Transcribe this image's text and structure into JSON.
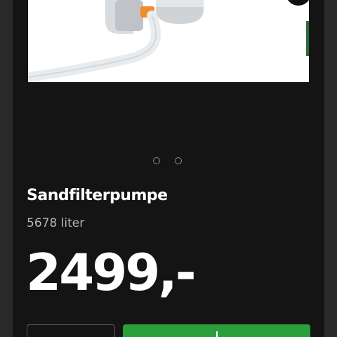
{
  "product": {
    "title": "Sandfilterpumpe",
    "capacity": "5678 liter",
    "price": "2499,-"
  },
  "carousel": {
    "slide_count": 2
  },
  "actions": {
    "quantity_value": "",
    "buy_label": ""
  },
  "colors": {
    "background": "#141414",
    "buy_button": "#2ba03a",
    "accent_orange": "#f28c28"
  }
}
